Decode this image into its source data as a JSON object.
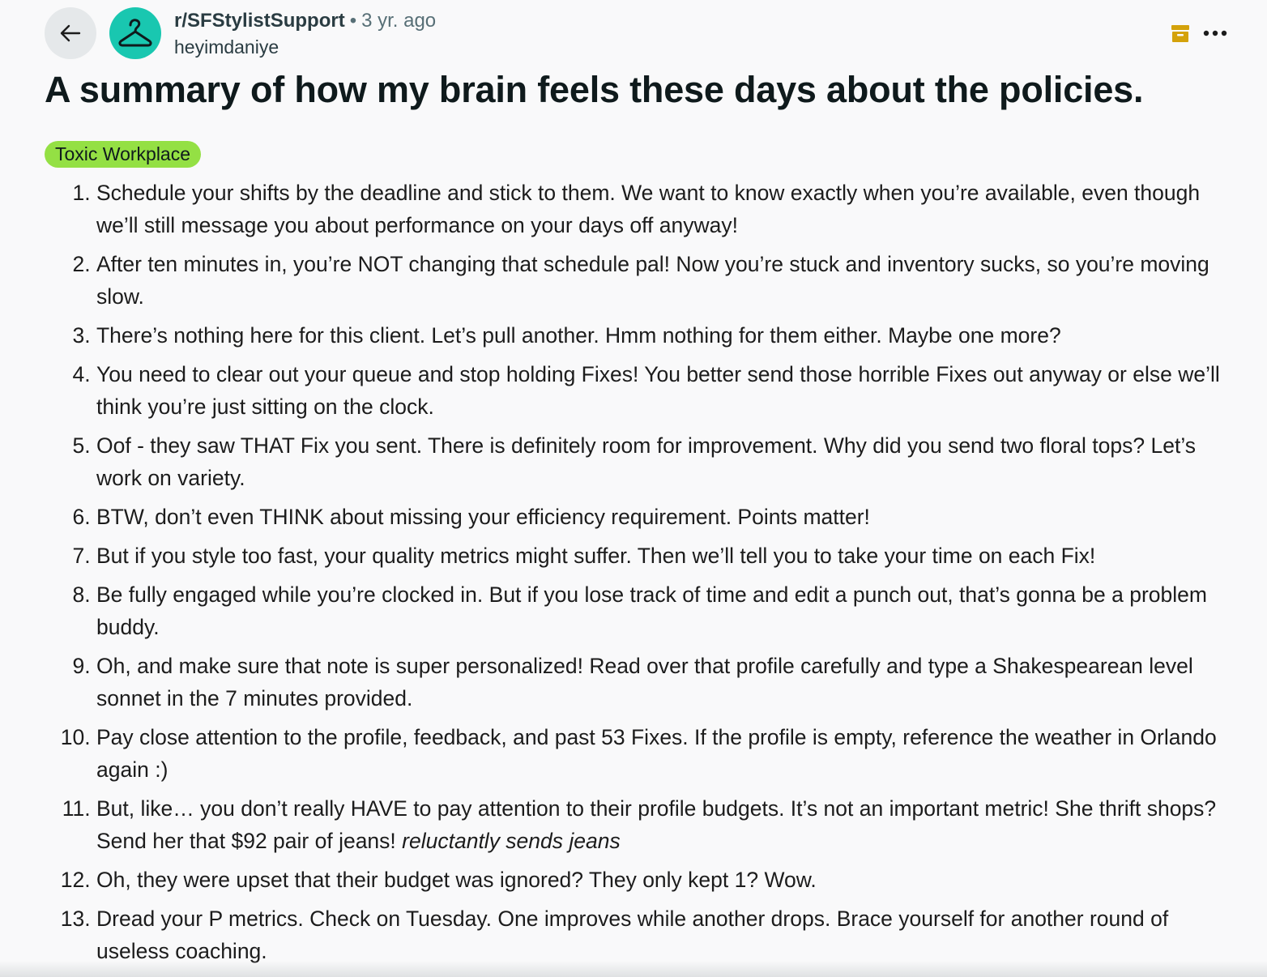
{
  "post": {
    "subreddit": "r/SFStylistSupport",
    "separator": "•",
    "time_ago": "3 yr. ago",
    "author": "heyimdaniye",
    "title": "A summary of how my brain feels these days about the policies.",
    "flair": {
      "label": "Toxic Workplace",
      "color": "#94e044"
    },
    "avatar_color": "#19c7b0",
    "archive_icon_color": "#d4a20b",
    "icons": {
      "back": "arrow-left-icon",
      "avatar": "hanger-icon",
      "archived": "archive-icon",
      "more": "ellipsis-icon"
    },
    "items": [
      {
        "text": "Schedule your shifts by the deadline and stick to them. We want to know exactly when you’re available, even though we’ll still message you about performance on your days off anyway!"
      },
      {
        "text": "After ten minutes in, you’re NOT changing that schedule pal! Now you’re stuck and inventory sucks, so you’re moving slow."
      },
      {
        "text": "There’s nothing here for this client. Let’s pull another. Hmm nothing for them either. Maybe one more?"
      },
      {
        "text": "You need to clear out your queue and stop holding Fixes! You better send those horrible Fixes out anyway or else we’ll think you’re just sitting on the clock."
      },
      {
        "text": "Oof - they saw THAT Fix you sent. There is definitely room for improvement. Why did you send two floral tops? Let’s work on variety."
      },
      {
        "text": "BTW, don’t even THINK about missing your efficiency requirement. Points matter!"
      },
      {
        "text": "But if you style too fast, your quality metrics might suffer. Then we’ll tell you to take your time on each Fix!"
      },
      {
        "text": "Be fully engaged while you’re clocked in. But if you lose track of time and edit a punch out, that’s gonna be a problem buddy."
      },
      {
        "text": "Oh, and make sure that note is super personalized! Read over that profile carefully and type a Shakespearean level sonnet in the 7 minutes provided."
      },
      {
        "text": "Pay close attention to the profile, feedback, and past 53 Fixes. If the profile is empty, reference the weather in Orlando again :)"
      },
      {
        "text": "But, like… you don’t really HAVE to pay attention to their profile budgets. It’s not an important metric! She thrift shops? Send her that $92 pair of jeans!",
        "italic": "reluctantly sends jeans"
      },
      {
        "text": "Oh, they were upset that their budget was ignored? They only kept 1? Wow."
      },
      {
        "text": "Dread your P metrics. Check on Tuesday. One improves while another drops. Brace yourself for another round of useless coaching."
      }
    ]
  }
}
